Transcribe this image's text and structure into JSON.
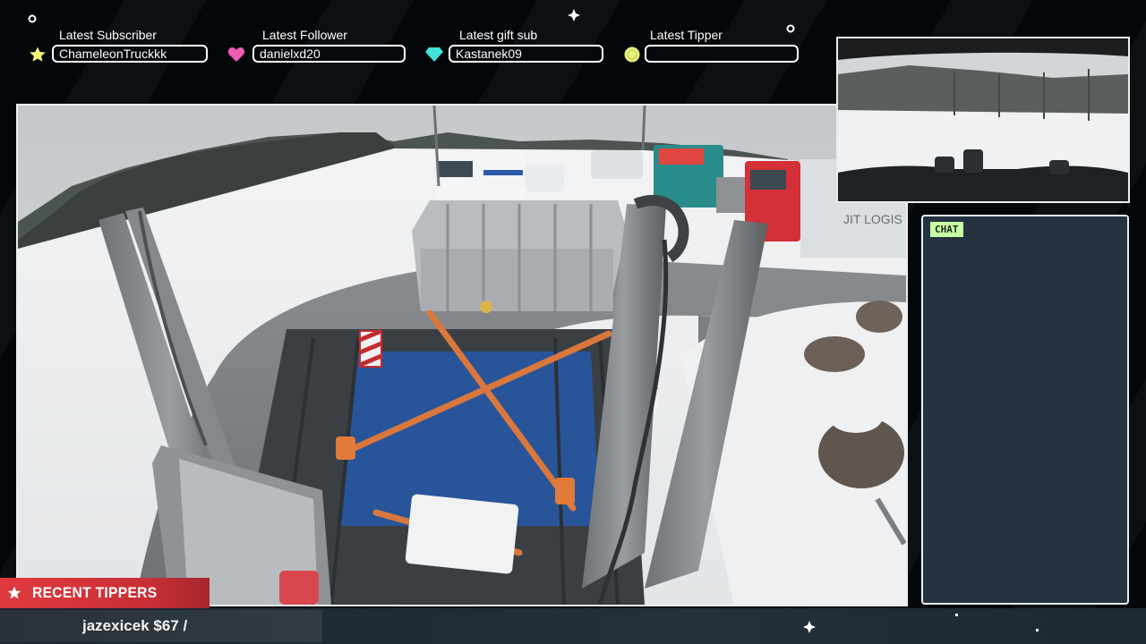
{
  "alerts": {
    "subscriber": {
      "title": "Latest Subscriber",
      "value": "ChameleonTruckkk",
      "icon": "star-icon",
      "color": "#f3f27a"
    },
    "follower": {
      "title": "Latest Follower",
      "value": "danielxd20",
      "icon": "heart-icon",
      "color": "#f25bb5"
    },
    "gift_sub": {
      "title": "Latest gift sub",
      "value": "Kastanek09",
      "icon": "diamond-icon",
      "color": "#3fe3dc"
    },
    "tipper": {
      "title": "Latest Tipper",
      "value": "",
      "icon": "coin-icon",
      "color": "#e6f27a"
    }
  },
  "chat": {
    "label": "CHAT"
  },
  "recent_tippers": {
    "label": "RECENT TIPPERS",
    "ticker": "jazexicek $67 /",
    "accent": "#e03a3f"
  },
  "colors": {
    "background": "#04070a",
    "frame_border": "#e9eef2",
    "chat_background": "#24333f",
    "chat_tag": "#c8ffa6"
  }
}
